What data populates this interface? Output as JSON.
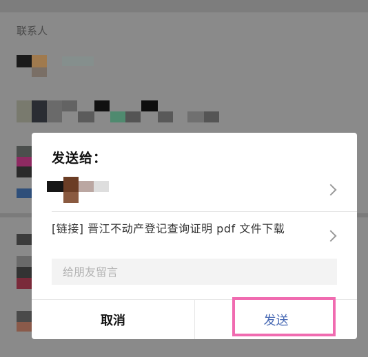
{
  "background": {
    "section_title": "联系人",
    "overlay_color": "#8a8a8a"
  },
  "dialog": {
    "title": "发送给：",
    "recipient": {
      "chevron_icon": "chevron-right-icon"
    },
    "shared_link": {
      "text": "[链接] 晋江不动产登记查询证明 pdf 文件下载",
      "chevron_icon": "chevron-right-icon"
    },
    "message_input": {
      "placeholder": "给朋友留言",
      "value": ""
    },
    "cancel_label": "取消",
    "send_label": "发送",
    "send_color": "#4a6bb5",
    "highlight_color": "#f06bb0"
  }
}
